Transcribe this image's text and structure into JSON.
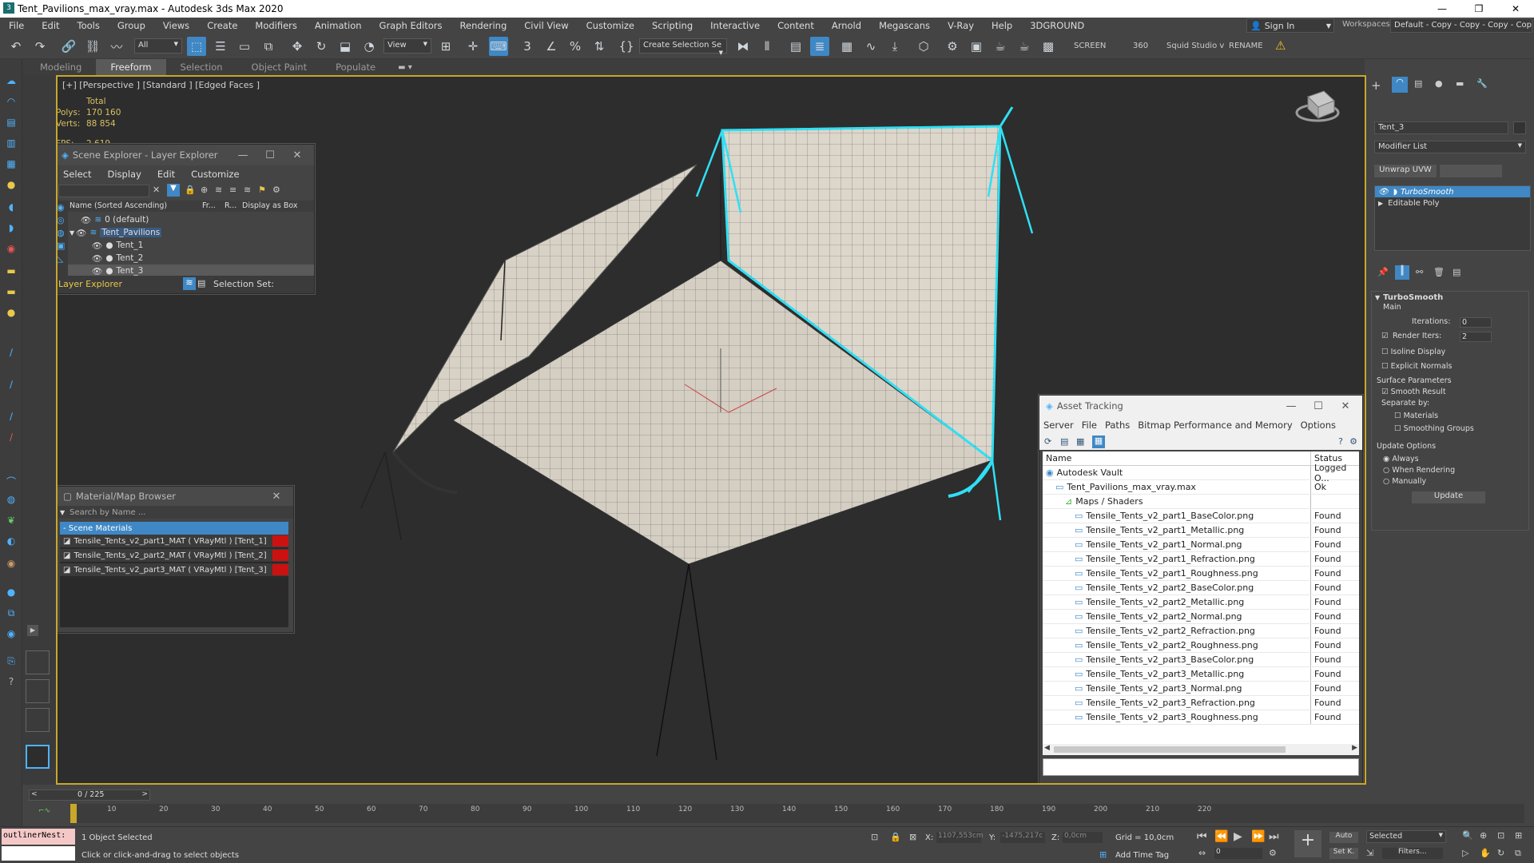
{
  "window": {
    "title": "Tent_Pavilions_max_vray.max - Autodesk 3ds Max 2020",
    "controls": [
      "—",
      "❐",
      "✕"
    ]
  },
  "menu": [
    "File",
    "Edit",
    "Tools",
    "Group",
    "Views",
    "Create",
    "Modifiers",
    "Animation",
    "Graph Editors",
    "Rendering",
    "Civil View",
    "Customize",
    "Scripting",
    "Interactive",
    "Content",
    "Arnold",
    "Megascans",
    "V-Ray",
    "Help",
    "3DGROUND"
  ],
  "account": {
    "sign_in": "Sign In",
    "workspaces_label": "Workspaces:",
    "workspace_value": "Default - Copy - Copy - Copy - Copy"
  },
  "toolbar": {
    "filter_value": "All",
    "ref_coord_value": "View",
    "selection_set_value": "Create Selection Se",
    "screen_label": "SCREEN",
    "value_360": "360",
    "squid_label": "Squid Studio v",
    "rename_label": "RENAME"
  },
  "ribbon": {
    "tabs": [
      "Modeling",
      "Freeform",
      "Selection",
      "Object Paint",
      "Populate"
    ],
    "active": "Freeform"
  },
  "viewport": {
    "label": "[+] [Perspective ] [Standard ] [Edged Faces ]",
    "stats_total": "Total",
    "polys_label": "Polys:",
    "polys_value": "170 160",
    "verts_label": "Verts:",
    "verts_value": "88 854",
    "fps_label": "FPS:",
    "fps_value": "2,619"
  },
  "scene_explorer": {
    "title": "Scene Explorer - Layer Explorer",
    "menu": [
      "Select",
      "Display",
      "Edit",
      "Customize"
    ],
    "col_name": "Name (Sorted Ascending)",
    "col_fr": "Fr...",
    "col_r": "R...",
    "col_box": "Display as Box",
    "rows": [
      {
        "label": "0 (default)",
        "indent": 0
      },
      {
        "label": "Tent_Pavilions",
        "indent": 0,
        "highlight": true
      },
      {
        "label": "Tent_1",
        "indent": 1
      },
      {
        "label": "Tent_2",
        "indent": 1
      },
      {
        "label": "Tent_3",
        "indent": 1,
        "selected": true
      }
    ],
    "footer_explorer": "Layer Explorer",
    "footer_selset": "Selection Set:"
  },
  "material_browser": {
    "title": "Material/Map Browser",
    "search_placeholder": "Search by Name ...",
    "group": "- Scene Materials",
    "items": [
      "Tensile_Tents_v2_part1_MAT  ( VRayMtl ) [Tent_1]",
      "Tensile_Tents_v2_part2_MAT  ( VRayMtl ) [Tent_2]",
      "Tensile_Tents_v2_part3_MAT  ( VRayMtl ) [Tent_3]"
    ]
  },
  "asset_tracking": {
    "title": "Asset Tracking",
    "menu": [
      "Server",
      "File",
      "Paths",
      "Bitmap Performance and Memory",
      "Options"
    ],
    "col_name": "Name",
    "col_status": "Status",
    "rows": [
      {
        "name": "Autodesk Vault",
        "status": "Logged O...",
        "indent": 1
      },
      {
        "name": "Tent_Pavilions_max_vray.max",
        "status": "Ok",
        "indent": 2
      },
      {
        "name": "Maps / Shaders",
        "status": "",
        "indent": 3
      },
      {
        "name": "Tensile_Tents_v2_part1_BaseColor.png",
        "status": "Found",
        "indent": 4
      },
      {
        "name": "Tensile_Tents_v2_part1_Metallic.png",
        "status": "Found",
        "indent": 4
      },
      {
        "name": "Tensile_Tents_v2_part1_Normal.png",
        "status": "Found",
        "indent": 4
      },
      {
        "name": "Tensile_Tents_v2_part1_Refraction.png",
        "status": "Found",
        "indent": 4
      },
      {
        "name": "Tensile_Tents_v2_part1_Roughness.png",
        "status": "Found",
        "indent": 4
      },
      {
        "name": "Tensile_Tents_v2_part2_BaseColor.png",
        "status": "Found",
        "indent": 4
      },
      {
        "name": "Tensile_Tents_v2_part2_Metallic.png",
        "status": "Found",
        "indent": 4
      },
      {
        "name": "Tensile_Tents_v2_part2_Normal.png",
        "status": "Found",
        "indent": 4
      },
      {
        "name": "Tensile_Tents_v2_part2_Refraction.png",
        "status": "Found",
        "indent": 4
      },
      {
        "name": "Tensile_Tents_v2_part2_Roughness.png",
        "status": "Found",
        "indent": 4
      },
      {
        "name": "Tensile_Tents_v2_part3_BaseColor.png",
        "status": "Found",
        "indent": 4
      },
      {
        "name": "Tensile_Tents_v2_part3_Metallic.png",
        "status": "Found",
        "indent": 4
      },
      {
        "name": "Tensile_Tents_v2_part3_Normal.png",
        "status": "Found",
        "indent": 4
      },
      {
        "name": "Tensile_Tents_v2_part3_Refraction.png",
        "status": "Found",
        "indent": 4
      },
      {
        "name": "Tensile_Tents_v2_part3_Roughness.png",
        "status": "Found",
        "indent": 4
      }
    ]
  },
  "command_panel": {
    "object_name": "Tent_3",
    "modifier_list": "Modifier List",
    "unwrap_button": "Unwrap UVW",
    "stack": [
      "TurboSmooth",
      "Editable Poly"
    ],
    "rollout_title": "TurboSmooth",
    "main_label": "Main",
    "iterations_label": "Iterations:",
    "iterations_value": "0",
    "render_iters_label": "Render Iters:",
    "render_iters_value": "2",
    "isoline": "Isoline Display",
    "explicit_normals": "Explicit Normals",
    "surface_params": "Surface Parameters",
    "smooth_result": "Smooth Result",
    "separate_by": "Separate by:",
    "materials": "Materials",
    "smoothing_groups": "Smoothing Groups",
    "update_options": "Update Options",
    "always": "Always",
    "when_rendering": "When Rendering",
    "manually": "Manually",
    "update_button": "Update"
  },
  "timeline": {
    "frame_counter": "0 / 225",
    "ticks": [
      "10",
      "20",
      "30",
      "40",
      "50",
      "60",
      "70",
      "80",
      "90",
      "100",
      "110",
      "120",
      "130",
      "140",
      "150",
      "160",
      "170",
      "180",
      "190",
      "200",
      "210",
      "220"
    ]
  },
  "status": {
    "maxscript": "outlinerNest:",
    "selected": "1 Object Selected",
    "hint": "Click or click-and-drag to select objects",
    "x_label": "X:",
    "x_value": "1107,553cm",
    "y_label": "Y:",
    "y_value": "-1475,217c",
    "z_label": "Z:",
    "z_value": "0,0cm",
    "grid": "Grid = 10,0cm",
    "add_time_tag": "Add Time Tag",
    "auto": "Auto",
    "selected_dropdown": "Selected",
    "set_k": "Set K.",
    "filters": "Filters...",
    "frame_value": "0"
  },
  "colors": {
    "selection_cyan": "#2fe0f5",
    "viewport_border": "#c8a72b",
    "active_blue": "#4fb3ff"
  }
}
